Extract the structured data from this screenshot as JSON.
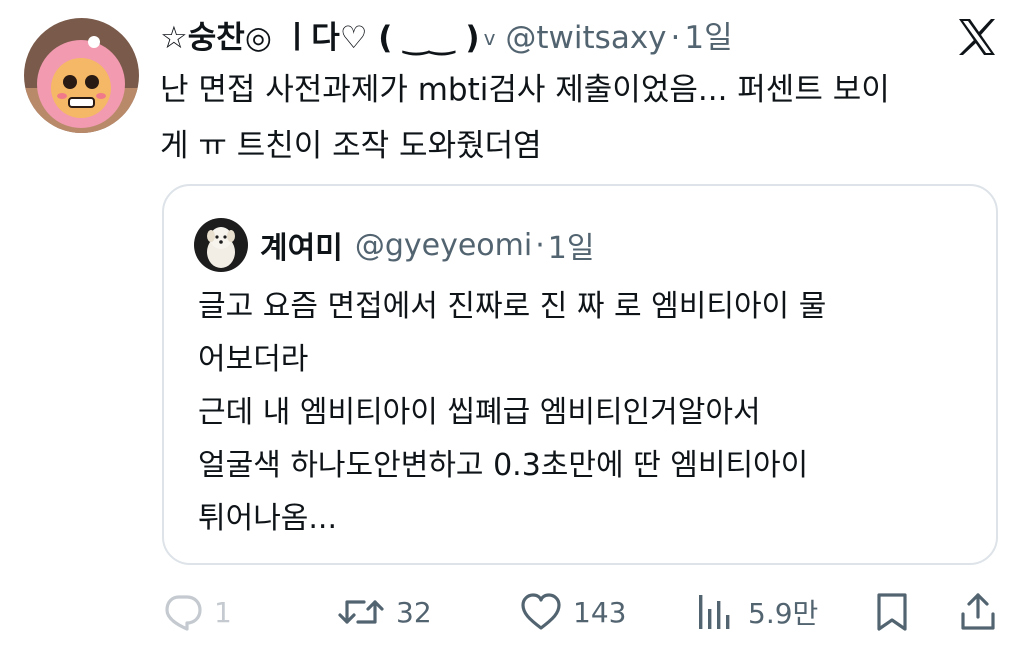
{
  "tweet": {
    "display_name": "☆숭찬◎ ㅣ다♡ ( ‿‿ )",
    "handle": "@twitsaxy",
    "separator": "·",
    "time": "1일",
    "text_line1": "난 면접 사전과제가 mbti검사 제출이었음... 퍼센트 보이",
    "text_line2": "게 ㅠ 트친이 조작 도와줬더염"
  },
  "quote": {
    "display_name": "계여미",
    "handle": "@gyeyeomi",
    "separator": "·",
    "time": "1일",
    "lines": [
      "글고 요즘 면접에서 진짜로 진 짜 로 엠비티아이 물",
      "어보더라",
      "근데 내 엠비티아이 씹폐급 엠비티인거알아서",
      "얼굴색 하나도안변하고 0.3초만에 딴 엠비티아이",
      "튀어나옴..."
    ]
  },
  "actions": {
    "reply_count": "1",
    "retweet_count": "32",
    "like_count": "143",
    "views_count": "5.9만"
  },
  "icons": {
    "reply": "reply-icon",
    "retweet": "retweet-icon",
    "like": "heart-icon",
    "views": "views-icon",
    "bookmark": "bookmark-icon",
    "share": "share-icon",
    "brand": "x-logo-icon"
  },
  "colors": {
    "text": "#0f1419",
    "secondary": "#536471",
    "border": "#dde3e8",
    "reply_faded": "#c4cad0"
  }
}
